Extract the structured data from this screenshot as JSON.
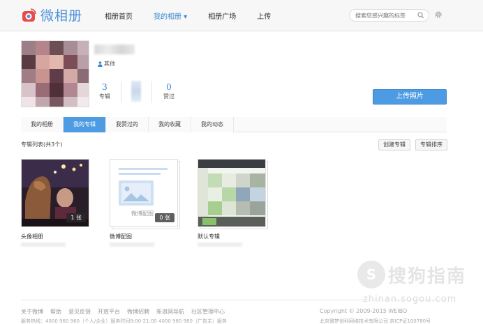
{
  "brand": {
    "name": "微相册"
  },
  "nav": {
    "items": [
      {
        "label": "相册首页"
      },
      {
        "label": "我的相册"
      },
      {
        "label": "相册广场"
      },
      {
        "label": "上传"
      }
    ],
    "active_index": 1
  },
  "search": {
    "placeholder": "搜索您感兴趣的标签"
  },
  "profile": {
    "gender_label": "其他",
    "stats": [
      {
        "value": "3",
        "label": "专辑"
      },
      {
        "value": "0",
        "label": "赞过"
      }
    ],
    "upload_label": "上传照片"
  },
  "tabs": [
    {
      "label": "我的相册"
    },
    {
      "label": "我的专辑"
    },
    {
      "label": "我赞过的"
    },
    {
      "label": "我的收藏"
    },
    {
      "label": "我的动态"
    }
  ],
  "active_tab": 1,
  "list": {
    "title": "专辑列表(共3个)",
    "create_label": "创建专辑",
    "sort_label": "专辑排序"
  },
  "albums": [
    {
      "title": "头像相册",
      "count": "1 张"
    },
    {
      "title": "微博配图",
      "count": "0 张",
      "placeholder_caption": "微博配图"
    },
    {
      "title": "默认专辑"
    }
  ],
  "footer": {
    "links": [
      "关于微博",
      "帮助",
      "意见反馈",
      "开放平台",
      "微博招聘",
      "新浪网导航",
      "社区管理中心"
    ],
    "phone": "服务热线：4000 960 960（个人/企业）服务时间9:00-21:00 4000 980 980（广告主）服务",
    "copyright": "Copyright © 2009-2015 WEIBO",
    "icp": "北京微梦创科网络技术有限公司 京ICP证100780号"
  },
  "watermark": {
    "text": "搜狗指南",
    "url": "zhinan.sogou.com"
  },
  "colors": {
    "accent": "#4d9be3",
    "link": "#3a86d6"
  }
}
